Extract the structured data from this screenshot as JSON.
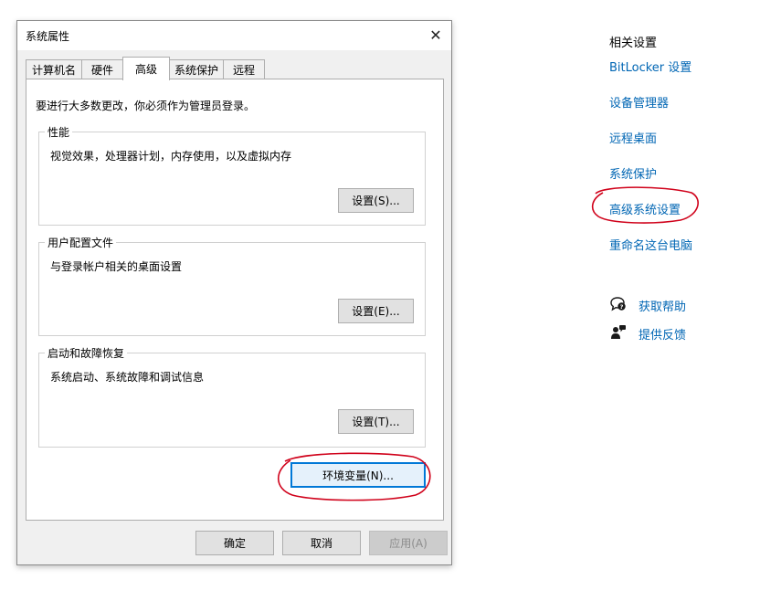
{
  "dialog": {
    "title": "系统属性",
    "tabs": [
      {
        "label": "计算机名",
        "active": false
      },
      {
        "label": "硬件",
        "active": false
      },
      {
        "label": "高级",
        "active": true
      },
      {
        "label": "系统保护",
        "active": false
      },
      {
        "label": "远程",
        "active": false
      }
    ],
    "admin_note": "要进行大多数更改，你必须作为管理员登录。",
    "groups": [
      {
        "title": "性能",
        "description": "视觉效果，处理器计划，内存使用，以及虚拟内存",
        "button": "设置(S)..."
      },
      {
        "title": "用户配置文件",
        "description": "与登录帐户相关的桌面设置",
        "button": "设置(E)..."
      },
      {
        "title": "启动和故障恢复",
        "description": "系统启动、系统故障和调试信息",
        "button": "设置(T)..."
      }
    ],
    "env_button": "环境变量(N)...",
    "footer": {
      "ok": "确定",
      "cancel": "取消",
      "apply": "应用(A)"
    }
  },
  "related_settings": {
    "heading": "相关设置",
    "links": [
      "BitLocker 设置",
      "设备管理器",
      "远程桌面",
      "系统保护",
      "高级系统设置",
      "重命名这台电脑"
    ],
    "help": [
      {
        "label": "获取帮助",
        "icon": "chat-help-icon"
      },
      {
        "label": "提供反馈",
        "icon": "feedback-icon"
      }
    ]
  },
  "colors": {
    "link": "#0066b4",
    "annotation": "#d0021b",
    "focus": "#0078d7"
  }
}
